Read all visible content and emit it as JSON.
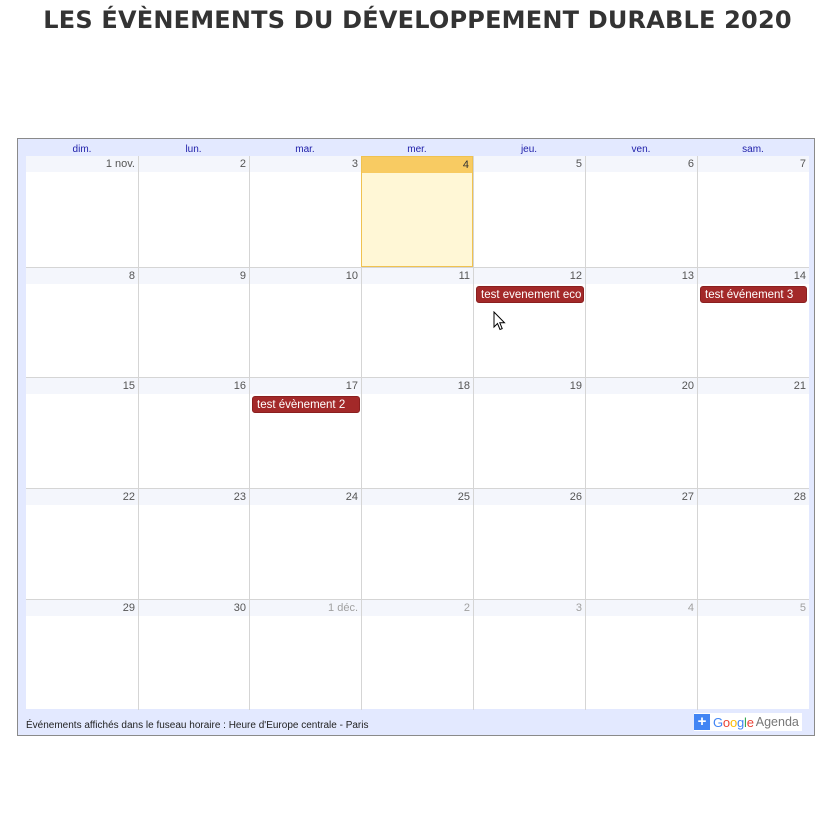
{
  "page": {
    "title": "LES ÉVÈNEMENTS DU DÉVELOPPEMENT DURABLE 2020"
  },
  "calendar": {
    "day_headers": [
      "dim.",
      "lun.",
      "mar.",
      "mer.",
      "jeu.",
      "ven.",
      "sam."
    ],
    "weeks": [
      [
        {
          "label": "1 nov.",
          "other": false
        },
        {
          "label": "2",
          "other": false
        },
        {
          "label": "3",
          "other": false
        },
        {
          "label": "4",
          "other": false,
          "today": true
        },
        {
          "label": "5",
          "other": false
        },
        {
          "label": "6",
          "other": false
        },
        {
          "label": "7",
          "other": false
        }
      ],
      [
        {
          "label": "8",
          "other": false
        },
        {
          "label": "9",
          "other": false
        },
        {
          "label": "10",
          "other": false
        },
        {
          "label": "11",
          "other": false
        },
        {
          "label": "12",
          "other": false,
          "event": "test evenement eco"
        },
        {
          "label": "13",
          "other": false
        },
        {
          "label": "14",
          "other": false,
          "event": "test événement 3"
        }
      ],
      [
        {
          "label": "15",
          "other": false
        },
        {
          "label": "16",
          "other": false
        },
        {
          "label": "17",
          "other": false,
          "event": "test évènement 2"
        },
        {
          "label": "18",
          "other": false
        },
        {
          "label": "19",
          "other": false
        },
        {
          "label": "20",
          "other": false
        },
        {
          "label": "21",
          "other": false
        }
      ],
      [
        {
          "label": "22",
          "other": false
        },
        {
          "label": "23",
          "other": false
        },
        {
          "label": "24",
          "other": false
        },
        {
          "label": "25",
          "other": false
        },
        {
          "label": "26",
          "other": false
        },
        {
          "label": "27",
          "other": false
        },
        {
          "label": "28",
          "other": false
        }
      ],
      [
        {
          "label": "29",
          "other": false
        },
        {
          "label": "30",
          "other": false
        },
        {
          "label": "1 déc.",
          "other": true
        },
        {
          "label": "2",
          "other": true
        },
        {
          "label": "3",
          "other": true
        },
        {
          "label": "4",
          "other": true
        },
        {
          "label": "5",
          "other": true
        }
      ]
    ],
    "footer": "Événements affichés dans le fuseau horaire : Heure d'Europe centrale - Paris",
    "badge": {
      "plus": "+",
      "google_letters": [
        {
          "ch": "G",
          "color": "#4285f4"
        },
        {
          "ch": "o",
          "color": "#ea4335"
        },
        {
          "ch": "o",
          "color": "#fbbc05"
        },
        {
          "ch": "g",
          "color": "#4285f4"
        },
        {
          "ch": "l",
          "color": "#34a853"
        },
        {
          "ch": "e",
          "color": "#ea4335"
        }
      ],
      "agenda": "Agenda"
    }
  },
  "colors": {
    "event_bg": "#a32929",
    "today_bg": "#fff7d6",
    "today_header": "#f8cb62",
    "frame_bg": "#e3e9ff"
  }
}
